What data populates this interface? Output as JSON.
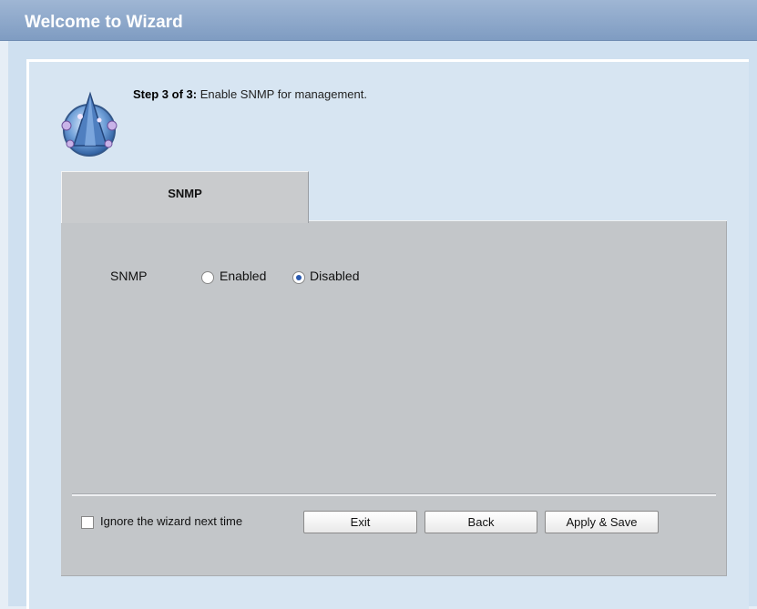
{
  "window": {
    "title": "Welcome to Wizard"
  },
  "step": {
    "prefix": "Step 3 of 3:",
    "text": " Enable SNMP for management."
  },
  "tabs": [
    {
      "label": "SNMP"
    }
  ],
  "snmp": {
    "label": "SNMP",
    "options": [
      {
        "label": "Enabled",
        "selected": false
      },
      {
        "label": "Disabled",
        "selected": true
      }
    ]
  },
  "footer": {
    "ignore_label": "Ignore the wizard next time",
    "ignore_checked": false,
    "buttons": {
      "exit": "Exit",
      "back": "Back",
      "apply": "Apply & Save"
    }
  },
  "icons": {
    "wizard": "wizard-hat-icon"
  },
  "colors": {
    "titlebar": "#8aa6c8",
    "panel": "#c3c6c9",
    "background": "#d7e5f2"
  }
}
